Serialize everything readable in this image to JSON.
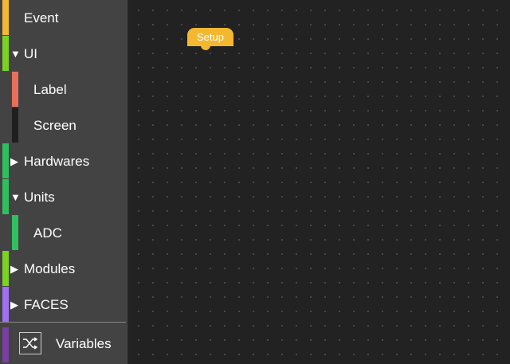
{
  "sidebar": {
    "categories": [
      {
        "label": "Event",
        "color": "#f4b830"
      },
      {
        "label": "UI",
        "color": "#7ad321",
        "expanded": true,
        "arrow": "▼"
      },
      {
        "label": "Label",
        "color": "#e8705a"
      },
      {
        "label": "Screen",
        "color": "#1f1f1f"
      },
      {
        "label": "Hardwares",
        "color": "#2fbf5f",
        "arrow": "▶"
      },
      {
        "label": "Units",
        "color": "#2fbf5f",
        "expanded": true,
        "arrow": "▼"
      },
      {
        "label": "ADC",
        "color": "#2fbf5f"
      },
      {
        "label": "Modules",
        "color": "#7ad321",
        "arrow": "▶"
      },
      {
        "label": "FACES",
        "color": "#a070f0",
        "arrow": "▶"
      }
    ],
    "variables": {
      "label": "Variables",
      "color": "#7a3fa0",
      "icon": "shuffle-icon"
    }
  },
  "workspace": {
    "blocks": [
      {
        "label": "Setup",
        "color": "#f4b830"
      }
    ]
  }
}
